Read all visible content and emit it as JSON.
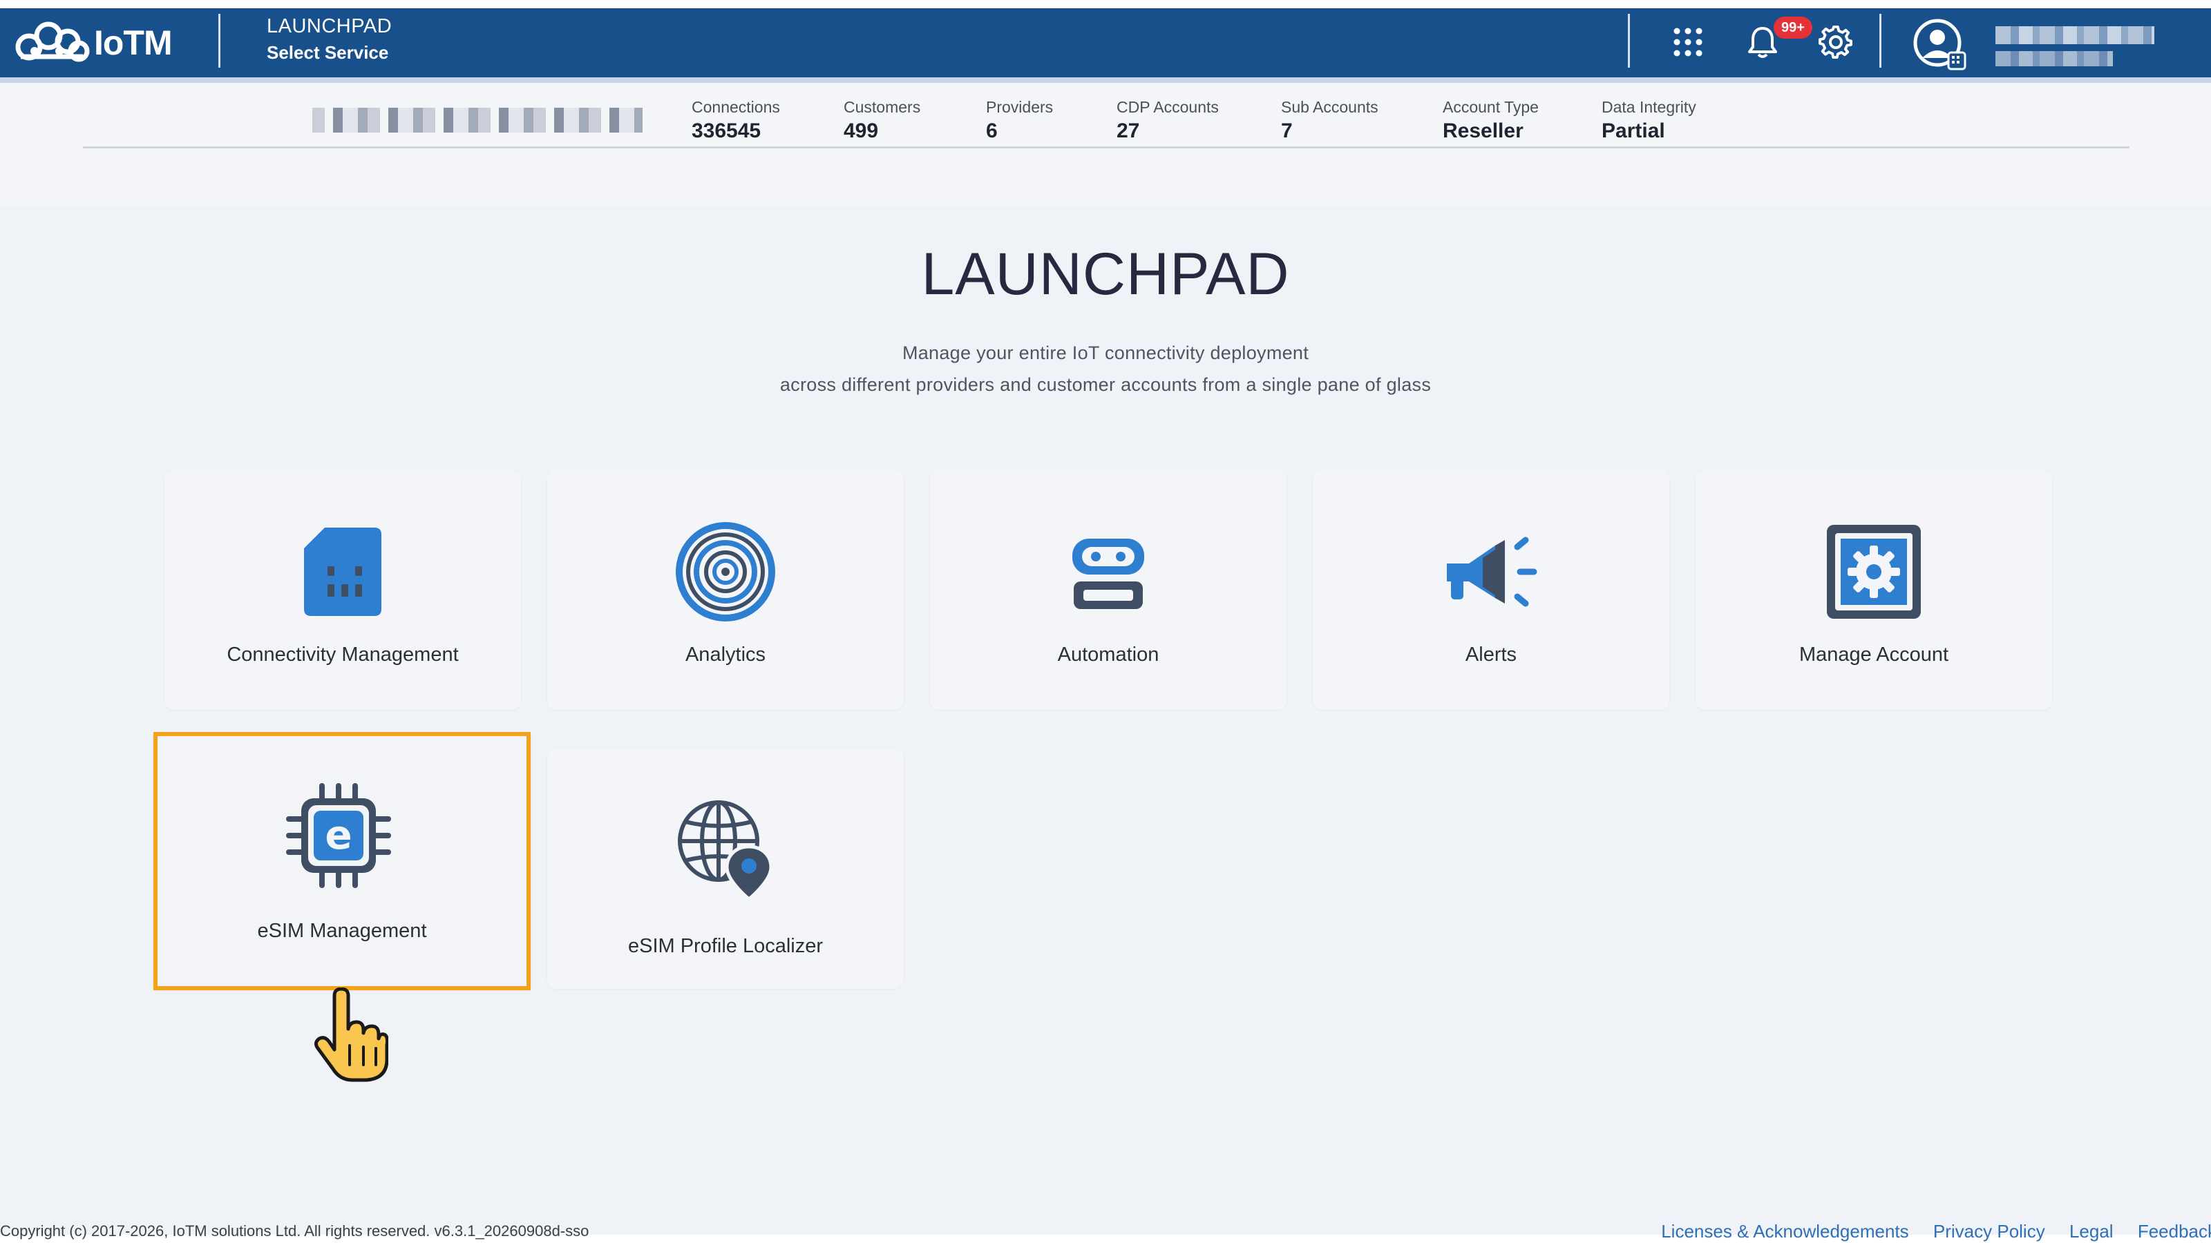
{
  "colors": {
    "topbar": "#18508c",
    "accent_blue": "#2f7fd0",
    "icon_dark": "#3f4e63",
    "selection": "#f5a21b",
    "badge": "#e53238",
    "link": "#2f6fb5"
  },
  "header": {
    "brand": "IoTM",
    "title": "LAUNCHPAD",
    "subtitle": "Select Service",
    "notification_badge": "99+",
    "icons": [
      "apps-grid-icon",
      "bell-icon",
      "gear-icon",
      "user-avatar-icon"
    ]
  },
  "stats": [
    {
      "label": "Connections",
      "value": "336545"
    },
    {
      "label": "Customers",
      "value": "499"
    },
    {
      "label": "Providers",
      "value": "6"
    },
    {
      "label": "CDP Accounts",
      "value": "27"
    },
    {
      "label": "Sub Accounts",
      "value": "7"
    },
    {
      "label": "Account Type",
      "value": "Reseller"
    },
    {
      "label": "Data Integrity",
      "value": "Partial"
    }
  ],
  "main": {
    "heading": "LAUNCHPAD",
    "description_line1": "Manage your entire IoT connectivity deployment",
    "description_line2": "across different providers and customer accounts from a single pane of glass"
  },
  "services": [
    {
      "label": "Connectivity Management",
      "icon": "sim-card-icon"
    },
    {
      "label": "Analytics",
      "icon": "radar-icon"
    },
    {
      "label": "Automation",
      "icon": "robot-icon"
    },
    {
      "label": "Alerts",
      "icon": "megaphone-icon"
    },
    {
      "label": "Manage Account",
      "icon": "account-gear-icon"
    },
    {
      "label": "eSIM Management",
      "icon": "esim-chip-icon",
      "selected": true
    },
    {
      "label": "eSIM Profile Localizer",
      "icon": "globe-pin-icon"
    }
  ],
  "footer": {
    "copyright": "Copyright (c) 2017-2026, IoTM solutions Ltd. All rights reserved. v6.3.1_20260908d-sso",
    "links": [
      "Licenses & Acknowledgements",
      "Privacy Policy",
      "Legal",
      "Feedback"
    ]
  }
}
